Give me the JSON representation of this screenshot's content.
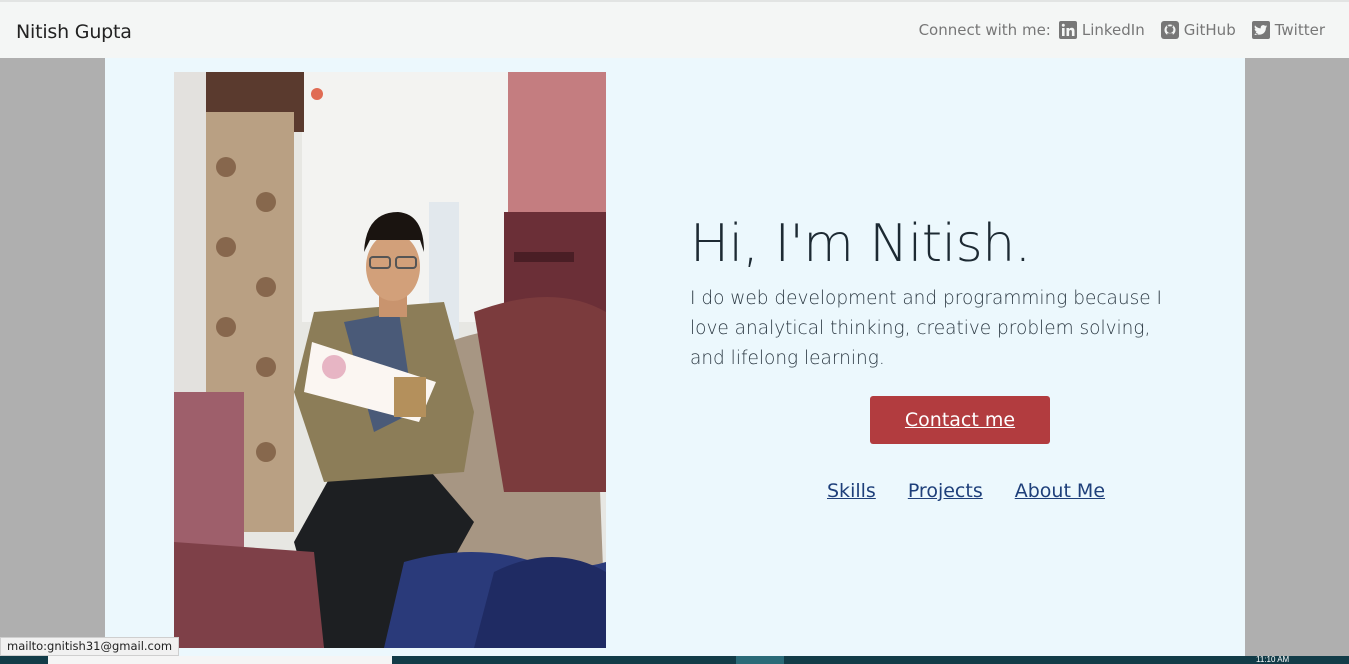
{
  "navbar": {
    "brand": "Nitish Gupta",
    "connect_label": "Connect with me:",
    "links": [
      {
        "label": "LinkedIn",
        "icon": "linkedin-icon"
      },
      {
        "label": "GitHub",
        "icon": "github-icon"
      },
      {
        "label": "Twitter",
        "icon": "twitter-icon"
      }
    ]
  },
  "hero": {
    "heading": "Hi, I'm Nitish.",
    "intro": "I do web development and programming because I love analytical thinking, creative problem solving, and lifelong learning.",
    "contact_button": "Contact me",
    "nav_links": [
      "Skills",
      "Projects",
      "About Me"
    ]
  },
  "status_bar": {
    "url": "mailto:gnitish31@gmail.com"
  },
  "taskbar": {
    "clock": "11:10 AM"
  },
  "colors": {
    "accent": "#b23c3f",
    "link": "#1e3f7a",
    "content_bg": "#ecf8fd",
    "navbar_bg": "#f4f6f5"
  }
}
